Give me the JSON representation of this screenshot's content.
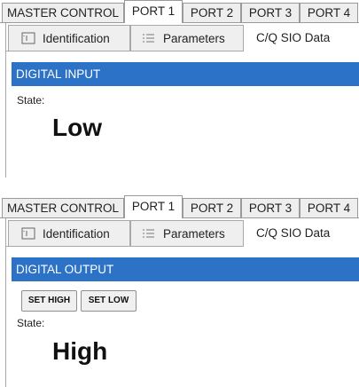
{
  "panels": [
    {
      "port_tabs": [
        "MASTER CONTROL",
        "PORT 1",
        "PORT 2",
        "PORT 3",
        "PORT 4"
      ],
      "active_port_tab": "PORT 1",
      "sub_tabs": [
        {
          "label": "Identification",
          "icon": "identification-icon"
        },
        {
          "label": "Parameters",
          "icon": "list-icon"
        },
        {
          "label": "C/Q SIO Data",
          "icon": ""
        }
      ],
      "active_sub_tab": "C/Q SIO Data",
      "section_title": "DIGITAL INPUT",
      "state_label": "State:",
      "state_value": "Low"
    },
    {
      "port_tabs": [
        "MASTER CONTROL",
        "PORT 1",
        "PORT 2",
        "PORT 3",
        "PORT 4"
      ],
      "active_port_tab": "PORT 1",
      "sub_tabs": [
        {
          "label": "Identification",
          "icon": "identification-icon"
        },
        {
          "label": "Parameters",
          "icon": "list-icon"
        },
        {
          "label": "C/Q SIO Data",
          "icon": ""
        }
      ],
      "active_sub_tab": "C/Q SIO Data",
      "section_title": "DIGITAL OUTPUT",
      "buttons": {
        "set_high": "SET HIGH",
        "set_low": "SET LOW"
      },
      "state_label": "State:",
      "state_value": "High"
    }
  ],
  "colors": {
    "header_blue": "#2c72c7",
    "tab_border": "#9a9a9a"
  }
}
